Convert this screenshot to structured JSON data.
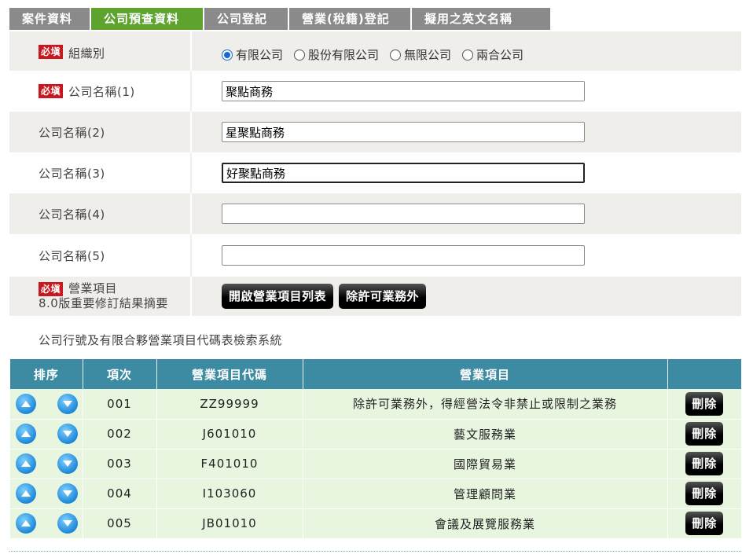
{
  "tabs": [
    {
      "label": "案件資料",
      "active": false
    },
    {
      "label": "公司預查資料",
      "active": true
    },
    {
      "label": "公司登記",
      "active": false
    },
    {
      "label": "營業(稅籍)登記",
      "active": false
    },
    {
      "label": "擬用之英文名稱",
      "active": false
    }
  ],
  "form": {
    "required_badge": "必塡",
    "org_type": {
      "label": "組織別",
      "options": [
        "有限公司",
        "股份有限公司",
        "無限公司",
        "兩合公司"
      ],
      "selected": "有限公司"
    },
    "names": [
      {
        "label": "公司名稱(1)",
        "value": "聚點商務"
      },
      {
        "label": "公司名稱(2)",
        "value": "星聚點商務"
      },
      {
        "label": "公司名稱(3)",
        "value": "好聚點商務"
      },
      {
        "label": "公司名稱(4)",
        "value": ""
      },
      {
        "label": "公司名稱(5)",
        "value": ""
      }
    ],
    "business": {
      "label": "營業項目",
      "sublabel": "8.0版重要修訂結果摘要",
      "open_list_button": "開啟營業項目列表",
      "except_button": "除許可業務外"
    }
  },
  "system_title": "公司行號及有限合夥營業項目代碼表檢索系統",
  "table": {
    "headers": [
      "排序",
      "項次",
      "營業項目代碼",
      "營業項目",
      ""
    ],
    "delete_label": "刪除",
    "rows": [
      {
        "no": "001",
        "code": "ZZ99999",
        "item": "除許可業務外，得經營法令非禁止或限制之業務"
      },
      {
        "no": "002",
        "code": "J601010",
        "item": "藝文服務業"
      },
      {
        "no": "003",
        "code": "F401010",
        "item": "國際貿易業"
      },
      {
        "no": "004",
        "code": "I103060",
        "item": "管理顧問業"
      },
      {
        "no": "005",
        "code": "JB01010",
        "item": "會議及展覽服務業"
      }
    ]
  },
  "colors": {
    "active_tab": "#5fa32f",
    "inactive_tab": "#8a8a8a",
    "required": "#c8171e",
    "table_header": "#3d8aa3",
    "table_row": "#e8f6e0"
  }
}
